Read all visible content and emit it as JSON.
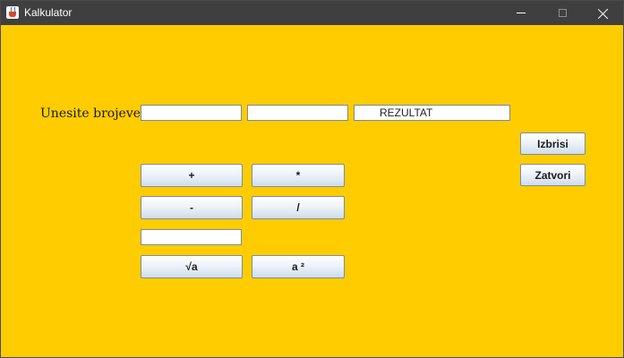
{
  "window": {
    "title": "Kalkulator"
  },
  "form": {
    "prompt_label": "Unesite brojeve:",
    "input1_value": "",
    "input2_value": "",
    "result_value": "REZULTAT",
    "single_input_value": ""
  },
  "buttons": {
    "plus": "+",
    "multiply": "*",
    "minus": "-",
    "divide": "/",
    "sqrt": "√a",
    "square": "a ²",
    "clear": "Izbrisi",
    "close": "Zatvori"
  },
  "colors": {
    "background": "#ffcc00",
    "titlebar": "#3f3f3f"
  }
}
